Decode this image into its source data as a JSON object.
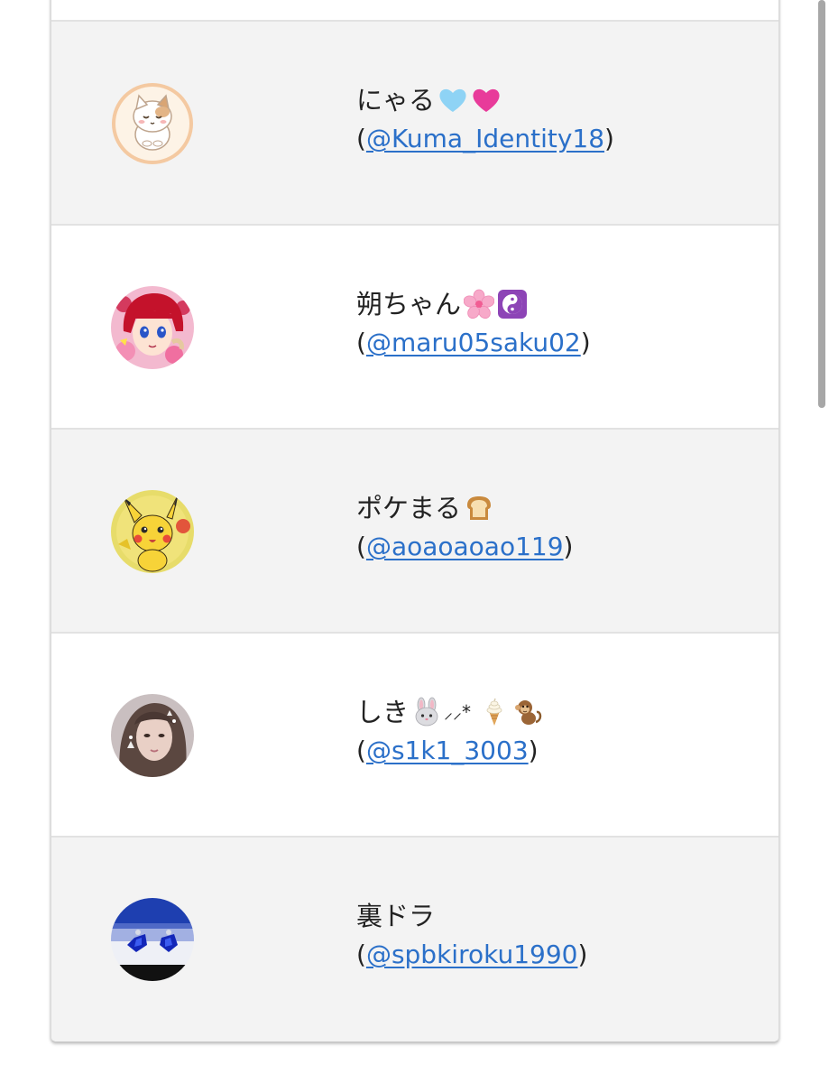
{
  "users": [
    {
      "name": "にゃる",
      "handle": "@Kuma_Identity18",
      "emojis": [
        "light-blue-heart-icon",
        "pink-heart-icon"
      ],
      "avatar_icon": "cat-avatar-icon",
      "shaded": true
    },
    {
      "name": "朔ちゃん",
      "handle": "@maru05saku02",
      "emojis": [
        "cherry-blossom-icon",
        "yin-yang-icon"
      ],
      "avatar_icon": "anime-girl-avatar-icon",
      "shaded": false
    },
    {
      "name": "ポケまる",
      "handle": "@aoaoaoao119",
      "emojis": [
        "bread-icon"
      ],
      "avatar_icon": "pikachu-avatar-icon",
      "shaded": true
    },
    {
      "name": "しき",
      "name_suffix": "⸝⸝*",
      "handle": "@s1k1_3003",
      "emojis": [
        "rabbit-face-icon",
        "soft-ice-cream-icon",
        "monkey-icon"
      ],
      "avatar_icon": "portrait-avatar-icon",
      "shaded": false
    },
    {
      "name": "裏ドラ",
      "handle": "@spbkiroku1990",
      "emojis": [],
      "avatar_icon": "blue-gem-earrings-avatar-icon",
      "shaded": true
    }
  ],
  "punctuation": {
    "open": "(",
    "close": ")"
  },
  "colors": {
    "link": "#2b70c9",
    "row_shaded": "#f3f3f3",
    "row_plain": "#ffffff",
    "text": "#222222"
  }
}
